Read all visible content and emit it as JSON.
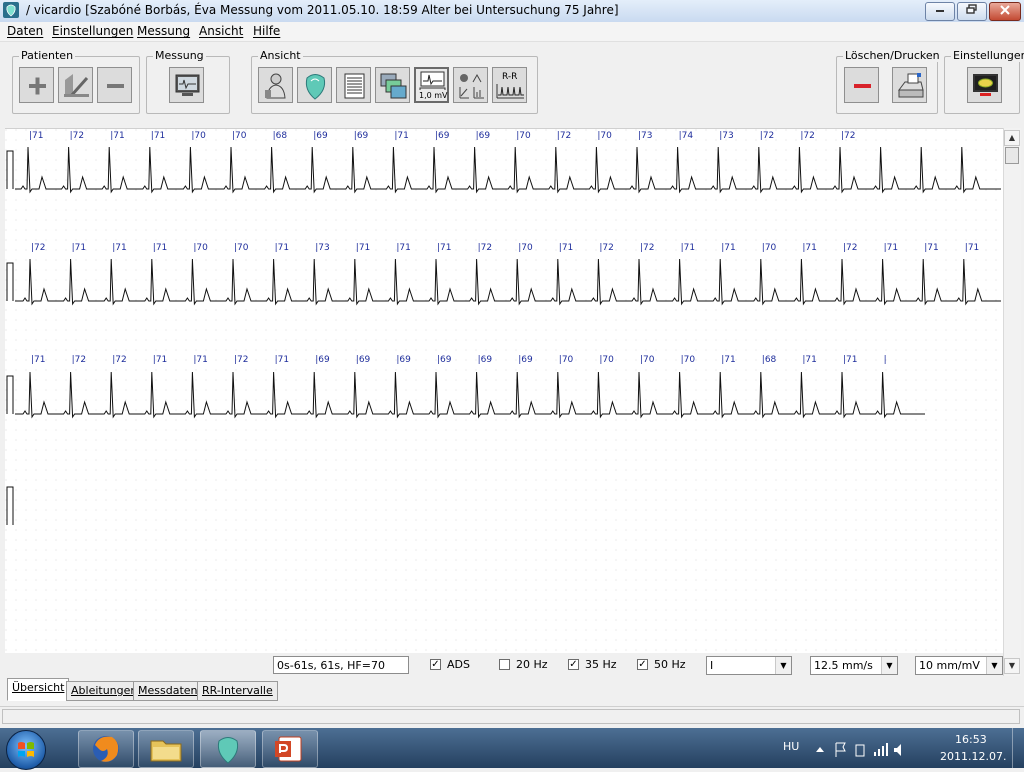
{
  "window": {
    "title": "/ vicardio [Szabóné Borbás, Éva Messung vom 2011.05.10. 18:59 Alter bei Untersuchung 75 Jahre]"
  },
  "menu": [
    "Daten",
    "Einstellungen",
    "Messung",
    "Ansicht",
    "Hilfe"
  ],
  "toolbar": {
    "patienten_label": "Patienten",
    "messung_label": "Messung",
    "ansicht_label": "Ansicht",
    "loeschen_label": "Löschen/Drucken",
    "einstellungen_label": "Einstellungen",
    "scale_button_text": "1,0 mV",
    "rr_button_text": "R-R"
  },
  "ecg": {
    "hr_rows": [
      [
        "71",
        "72",
        "71",
        "71",
        "70",
        "70",
        "68",
        "69",
        "69",
        "71",
        "69",
        "69",
        "70",
        "72",
        "70",
        "73",
        "74",
        "73",
        "72",
        "72",
        "72"
      ],
      [
        "72",
        "71",
        "71",
        "71",
        "70",
        "70",
        "71",
        "73",
        "71",
        "71",
        "71",
        "72",
        "70",
        "71",
        "72",
        "72",
        "71",
        "71",
        "70",
        "71",
        "72",
        "71",
        "71",
        "71"
      ],
      [
        "71",
        "72",
        "72",
        "71",
        "71",
        "72",
        "71",
        "69",
        "69",
        "69",
        "69",
        "69",
        "69",
        "70",
        "70",
        "70",
        "70",
        "71",
        "68",
        "71",
        "71",
        ""
      ]
    ]
  },
  "controls": {
    "info_text": "0s-61s, 61s, HF=70",
    "checks": [
      {
        "label": "ADS",
        "checked": true
      },
      {
        "label": "20 Hz",
        "checked": false
      },
      {
        "label": "35 Hz",
        "checked": true
      },
      {
        "label": "50 Hz",
        "checked": true
      }
    ],
    "lead_value": "I",
    "speed_value": "12.5 mm/s",
    "gain_value": "10 mm/mV"
  },
  "tabs": [
    "Übersicht",
    "Ableitungen",
    "Messdaten",
    "RR-Intervalle"
  ],
  "taskbar": {
    "language": "HU",
    "time": "16:53",
    "date": "2011.12.07."
  },
  "colors": {
    "hr_label": "#1f2e9c",
    "trace": "#111111",
    "title_gradient_top": "#e4eefa"
  }
}
